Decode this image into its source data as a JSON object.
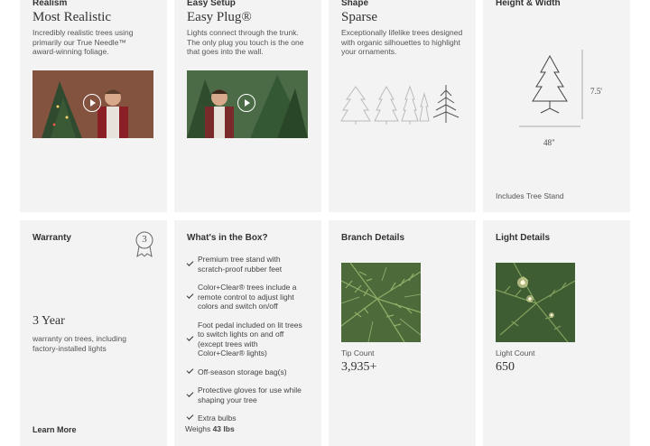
{
  "features": [
    {
      "label": "Realism",
      "title": "Most Realistic",
      "description": "Incredibly realistic trees using primarily our True Needle™ award-winning foliage."
    },
    {
      "label": "Easy Setup",
      "title": "Easy Plug®",
      "description": "Lights connect through the trunk. The only plug you touch is the one that goes into the wall."
    },
    {
      "label": "Shape",
      "title": "Sparse",
      "description": "Exceptionally lifelike trees designed with organic silhouettes to highlight your ornaments."
    },
    {
      "label": "Height & Width",
      "height": "7.5'",
      "width": "48\"",
      "note": "Includes Tree Stand"
    }
  ],
  "warranty": {
    "label": "Warranty",
    "badge": "3",
    "value": "3 Year",
    "description": "warranty on trees, including factory-installed lights",
    "link": "Learn More"
  },
  "box": {
    "label": "What's in the Box?",
    "items": [
      "Premium tree stand with scratch-proof rubber feet",
      "Color+Clear® trees include a remote control to adjust light colors and switch on/off",
      "Foot pedal included on lit trees to switch lights on and off (except trees with Color+Clear® lights)",
      "Off-season storage bag(s)",
      "Protective gloves for use while shaping your tree",
      "Extra bulbs"
    ],
    "weight_label": "Weighs",
    "weight_value": "43 lbs"
  },
  "branch": {
    "label": "Branch Details",
    "count_label": "Tip Count",
    "count": "3,935+"
  },
  "lights": {
    "label": "Light Details",
    "count_label": "Light Count",
    "count": "650"
  },
  "colors": {
    "card_bg": "#f3f3f3",
    "text": "#333333",
    "muted": "#555555"
  }
}
